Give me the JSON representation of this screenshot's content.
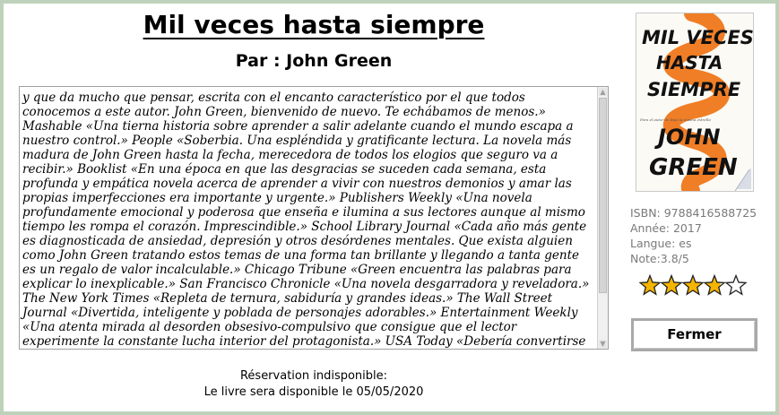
{
  "book": {
    "title": "Mil veces hasta siempre",
    "author_line": "Par : John Green",
    "description": "y que da mucho que pensar, escrita con el encanto característico por el que todos conocemos a este autor. John Green, bienvenido de nuevo. Te echábamos de menos.» Mashable «Una tierna historia sobre aprender a salir adelante cuando el mundo escapa a nuestro control.» People «Soberbia. Una espléndida y gratificante lectura. La novela más madura de John Green hasta la fecha, merecedora de todos los elogios que seguro va a recibir.» Booklist «En una época en que las desgracias se suceden cada semana, esta profunda y empática novela acerca de aprender a vivir con nuestros demonios y amar las propias imperfecciones era importante y urgente.» Publishers Weekly «Una novela profundamente emocional y poderosa que enseña e ilumina a sus lectores aunque al mismo tiempo les rompa el corazón. Imprescindible.» School Library Journal «Cada año más gente es diagnosticada de ansiedad, depresión y otros desórdenes mentales. Que exista alguien como John Green tratando estos temas de una forma tan brillante y llegando a tanta gente es un regalo de valor incalculable.» Chicago Tribune «Green encuentra las palabras para explicar lo inexplicable.» San Francisco Chronicle «Una novela desgarradora y reveladora.» The New York Times «Repleta de ternura, sabiduría y grandes ideas.» The Wall Street Journal «Divertida, inteligente y poblada de personajes adorables.» Entertainment Weekly «Una atenta mirada al desorden obsesivo-compulsivo que consigue que el lector experimente la constante lucha interior del protagonista.» USA Today «Debería convertirse en un clásico moderno.» The Guardian «El trabajo más auténtico y ambicioso de Green hasta la fecha.» Bustle «Un poderoso cuento para",
    "isbn": "ISBN: 9788416588725",
    "year": "Année: 2017",
    "language": "Langue: es",
    "rating_text": "Note:3.8/5",
    "rating_value": 3.8,
    "rating_max": 5
  },
  "cover": {
    "line1": "MIL VECES",
    "line2": "HASTA",
    "line3": "SIEMPRE",
    "line4": "JOHN",
    "line5": "GREEN",
    "tagline": "Para el autor de Bajo la misma estrella"
  },
  "status": {
    "line1": "Réservation indisponible:",
    "line2": "Le livre sera disponible le 05/05/2020"
  },
  "actions": {
    "close_label": "Fermer"
  },
  "colors": {
    "background": "#bed2bb",
    "star": "#f5b400",
    "cover_orange": "#f07e26"
  }
}
